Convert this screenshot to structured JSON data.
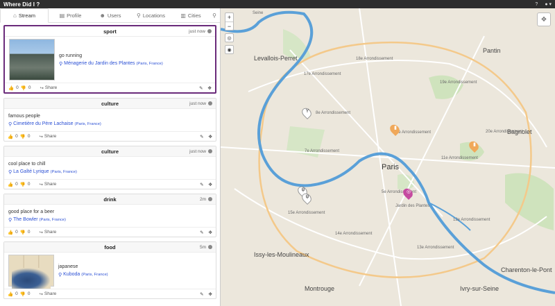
{
  "app": {
    "title": "Where Did I ?",
    "help_icon": "question-circle-icon",
    "user_icon": "user-icon"
  },
  "tabs": [
    {
      "label": "Stream",
      "icon": "home-icon"
    },
    {
      "label": "Profile",
      "icon": "file-icon"
    },
    {
      "label": "Users",
      "icon": "users-icon"
    },
    {
      "label": "Locations",
      "icon": "map-pin-icon"
    },
    {
      "label": "Cities",
      "icon": "building-icon"
    }
  ],
  "cards": [
    {
      "category": "sport",
      "time": "just now",
      "text": "go running",
      "place": "Ménagerie du Jardin des Plantes",
      "country": "(Paris, France)",
      "likes": "0",
      "dislikes": "0",
      "share": "Share"
    },
    {
      "category": "culture",
      "time": "just now",
      "text": "famous people",
      "place": "Cimetière du Père Lachaise",
      "country": "(Paris, France)",
      "likes": "0",
      "dislikes": "0",
      "share": "Share"
    },
    {
      "category": "culture",
      "time": "just now",
      "text": "cool place to chill",
      "place": "La Gaîté Lyrique",
      "country": "(Paris, France)",
      "likes": "0",
      "dislikes": "0",
      "share": "Share"
    },
    {
      "category": "drink",
      "time": "2m",
      "text": "good place for a beer",
      "place": "The Bowler",
      "country": "(Paris, France)",
      "likes": "0",
      "dislikes": "0",
      "share": "Share"
    },
    {
      "category": "food",
      "time": "5m",
      "text": "japanese",
      "place": "Kuboda",
      "country": "(Paris, France)",
      "likes": "0",
      "dislikes": "0",
      "share": "Share"
    }
  ],
  "map": {
    "zoom_in": "+",
    "zoom_out": "−",
    "labels": {
      "seine": "Seine",
      "levallois": "Levallois-Perret",
      "pantin": "Pantin",
      "bagnolet": "Bagnolet",
      "paris": "Paris",
      "issy": "Issy-les-Moulineaux",
      "montrouge": "Montrouge",
      "charenton": "Charenton-le-Pont",
      "ivry": "Ivry-sur-Seine",
      "jardin": "Jardin des Plantes",
      "arr17": "17e Arrondissement",
      "arr18": "18e Arrondissement",
      "arr19": "19e Arrondissement",
      "arr8": "8e Arrondissement",
      "arr7": "7e Arrondissement",
      "arr15": "15e Arrondissement",
      "arr14": "14e Arrondissement",
      "arr13": "13e Arrondissement",
      "arr12": "12e Arrondissement",
      "arr11": "11e Arrondissement",
      "arr20": "20e Arrondissement",
      "arr3": "3e Arrondissement",
      "arr5": "5e Arrondissement"
    }
  }
}
